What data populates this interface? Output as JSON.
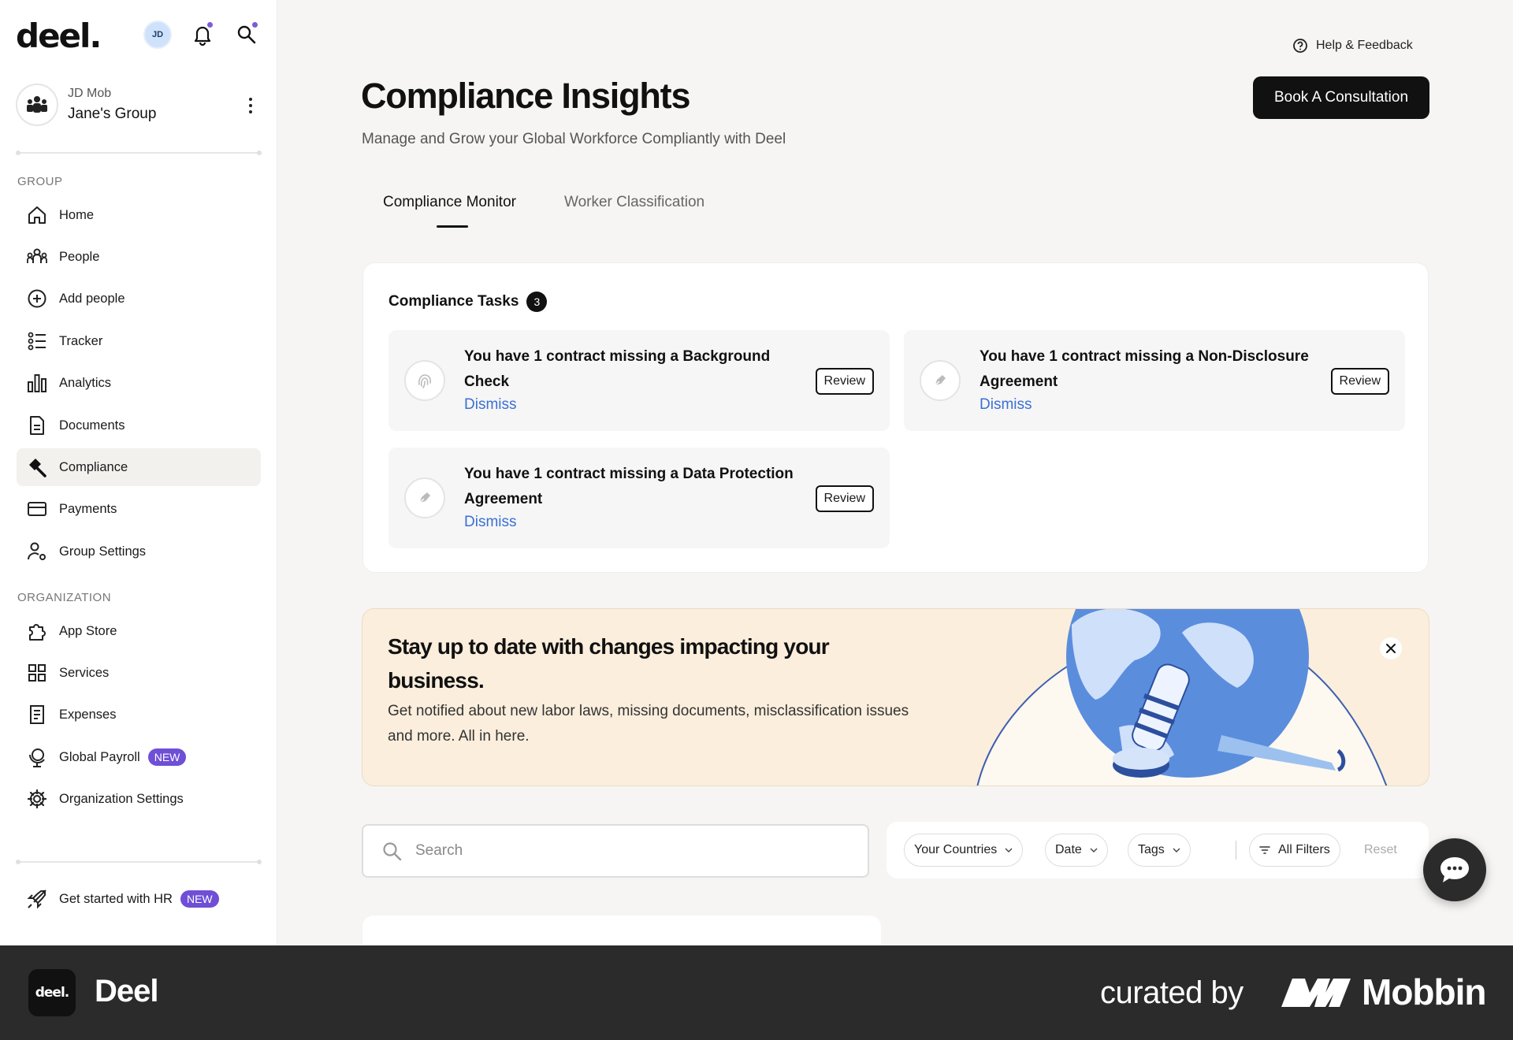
{
  "app": {
    "logo_text": "deel."
  },
  "topbar": {
    "avatar_initials": "JD"
  },
  "group": {
    "sub_label": "JD Mob",
    "name": "Jane's Group"
  },
  "sidebar": {
    "group_label": "GROUP",
    "group_items": [
      {
        "label": "Home",
        "icon": "home-icon"
      },
      {
        "label": "People",
        "icon": "people-icon"
      },
      {
        "label": "Add people",
        "icon": "plus-circle-icon"
      },
      {
        "label": "Tracker",
        "icon": "tracker-icon"
      },
      {
        "label": "Analytics",
        "icon": "bar-chart-icon"
      },
      {
        "label": "Documents",
        "icon": "document-icon"
      },
      {
        "label": "Compliance",
        "icon": "gavel-icon",
        "active": true
      },
      {
        "label": "Payments",
        "icon": "card-icon"
      },
      {
        "label": "Group Settings",
        "icon": "user-gear-icon"
      }
    ],
    "org_label": "ORGANIZATION",
    "org_items": [
      {
        "label": "App Store",
        "icon": "puzzle-icon"
      },
      {
        "label": "Services",
        "icon": "grid-icon"
      },
      {
        "label": "Expenses",
        "icon": "receipt-icon"
      },
      {
        "label": "Global Payroll",
        "icon": "globe-pin-icon",
        "badge": "NEW"
      },
      {
        "label": "Organization Settings",
        "icon": "gear-icon"
      }
    ],
    "bottom_item": {
      "label": "Get started with HR",
      "badge": "NEW",
      "icon": "rocket-icon"
    }
  },
  "header": {
    "help_label": "Help & Feedback",
    "book_button": "Book A Consultation",
    "title": "Compliance Insights",
    "subtitle": "Manage and Grow your Global Workforce Compliantly with Deel"
  },
  "tabs": [
    {
      "label": "Compliance Monitor",
      "active": true
    },
    {
      "label": "Worker Classification",
      "active": false
    }
  ],
  "tasks": {
    "title": "Compliance Tasks",
    "count": "3",
    "items": [
      {
        "text": "You have 1 contract missing a Background Check",
        "dismiss": "Dismiss",
        "review": "Review",
        "icon": "fingerprint-icon"
      },
      {
        "text": "You have 1 contract missing a Non-Disclosure Agreement",
        "dismiss": "Dismiss",
        "review": "Review",
        "icon": "pen-icon"
      },
      {
        "text": "You have 1 contract missing a Data Protection Agreement",
        "dismiss": "Dismiss",
        "review": "Review",
        "icon": "pen-icon"
      }
    ]
  },
  "promo": {
    "title": "Stay up to date with changes impacting your business.",
    "text": "Get notified about new labor laws, missing documents, misclassification issues and more. All in here."
  },
  "search": {
    "placeholder": "Search"
  },
  "filters": {
    "countries": "Your Countries",
    "date": "Date",
    "tags": "Tags",
    "all_filters": "All Filters",
    "reset": "Reset"
  },
  "footer": {
    "app_logo": "deel.",
    "app_name": "Deel",
    "curated_by": "curated by",
    "brand": "Mobbin"
  },
  "colors": {
    "accent_purple": "#6e4fd6",
    "link_blue": "#3b6fd4",
    "promo_bg": "#fbeedc"
  }
}
